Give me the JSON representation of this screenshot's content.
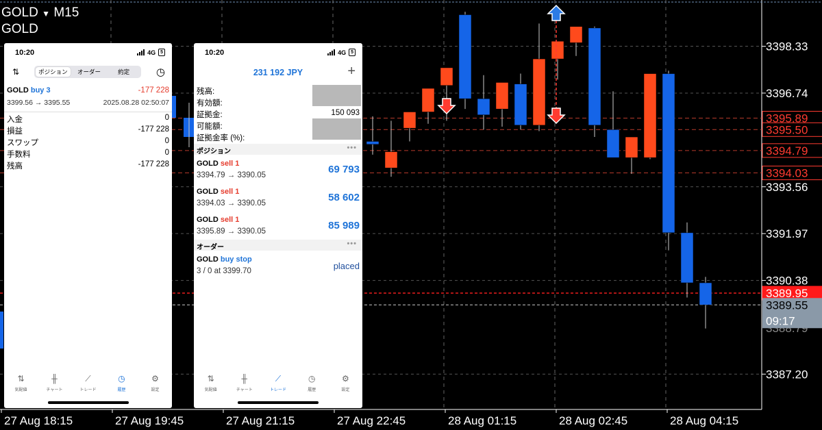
{
  "chart": {
    "symbol": "GOLD",
    "timeframe": "M15",
    "subtitle": "GOLD",
    "price_min": 3386.0,
    "price_max": 3399.9,
    "up_color": "#ff4a1c",
    "down_color": "#1565e8",
    "price_ticks": [
      "3398.33",
      "3396.74",
      "3393.56",
      "3391.97",
      "3390.38",
      "3387.20"
    ],
    "price_tick_values": [
      3398.33,
      3396.74,
      3393.56,
      3391.97,
      3390.38,
      3387.2
    ],
    "level_labels": [
      "3395.89",
      "3395.50",
      "3394.79",
      "3394.03"
    ],
    "level_values": [
      3395.89,
      3395.5,
      3394.79,
      3394.03
    ],
    "bid_label": "3389.95",
    "bid_value": 3389.95,
    "ask_label": "3389.55",
    "ask_value": 3389.55,
    "countdown": "09:17",
    "obscured_label": "3388.79",
    "time_labels": [
      "27 Aug 18:15",
      "27 Aug 19:45",
      "27 Aug 21:15",
      "27 Aug 22:45",
      "28 Aug 01:15",
      "28 Aug 02:45",
      "28 Aug 04:15"
    ],
    "candles": [
      {
        "o": 3395.1,
        "h": 3395.95,
        "l": 3394.65,
        "c": 3395.0
      },
      {
        "o": 3394.2,
        "h": 3395.8,
        "l": 3393.9,
        "c": 3394.75
      },
      {
        "o": 3395.55,
        "h": 3395.9,
        "l": 3395.1,
        "c": 3396.1
      },
      {
        "o": 3396.1,
        "h": 3396.8,
        "l": 3395.7,
        "c": 3396.9
      },
      {
        "o": 3397.0,
        "h": 3397.5,
        "l": 3395.8,
        "c": 3397.6
      },
      {
        "o": 3399.4,
        "h": 3399.5,
        "l": 3396.2,
        "c": 3396.55
      },
      {
        "o": 3396.55,
        "h": 3397.35,
        "l": 3395.5,
        "c": 3396.0
      },
      {
        "o": 3396.2,
        "h": 3396.95,
        "l": 3395.6,
        "c": 3397.1
      },
      {
        "o": 3397.05,
        "h": 3397.4,
        "l": 3395.5,
        "c": 3395.65
      },
      {
        "o": 3395.65,
        "h": 3399.1,
        "l": 3395.45,
        "c": 3397.9
      },
      {
        "o": 3397.9,
        "h": 3398.45,
        "l": 3397.2,
        "c": 3398.5
      },
      {
        "o": 3398.45,
        "h": 3398.9,
        "l": 3398.0,
        "c": 3399.0
      },
      {
        "o": 3398.95,
        "h": 3399.0,
        "l": 3395.25,
        "c": 3395.65
      },
      {
        "o": 3395.5,
        "h": 3396.8,
        "l": 3394.85,
        "c": 3394.55
      },
      {
        "o": 3394.55,
        "h": 3395.25,
        "l": 3394.0,
        "c": 3395.25
      },
      {
        "o": 3394.55,
        "h": 3397.3,
        "l": 3394.5,
        "c": 3397.4
      },
      {
        "o": 3397.4,
        "h": 3397.5,
        "l": 3391.4,
        "c": 3392.0
      },
      {
        "o": 3392.0,
        "h": 3392.35,
        "l": 3389.8,
        "c": 3390.3
      },
      {
        "o": 3390.3,
        "h": 3390.5,
        "l": 3388.75,
        "c": 3389.55
      }
    ]
  },
  "phone1": {
    "time": "10:20",
    "network": "4G",
    "battery": "5",
    "tabs": [
      "ポジション",
      "オーダー",
      "約定"
    ],
    "summary": {
      "symbol": "GOLD",
      "side": "buy 3",
      "profit": "-177 228",
      "prices": "3399.56 → 3395.55",
      "date": "2025.08.28 02:50:07"
    },
    "rows": [
      {
        "label": "入金",
        "value": "0"
      },
      {
        "label": "損益",
        "value": "-177 228"
      },
      {
        "label": "スワップ",
        "value": "0"
      },
      {
        "label": "手数料",
        "value": "0"
      },
      {
        "label": "残高",
        "value": "-177 228"
      }
    ],
    "nav": [
      "気配値",
      "チャート",
      "トレード",
      "履歴",
      "設定"
    ],
    "active_nav": "履歴"
  },
  "phone2": {
    "time": "10:20",
    "network": "4G",
    "battery": "5",
    "title": "231 192 JPY",
    "plus": "+",
    "account": [
      {
        "label": "残高:",
        "value": ""
      },
      {
        "label": "有効額:",
        "value": ""
      },
      {
        "label": "証拠金:",
        "value": "150 093"
      },
      {
        "label": "可能額:",
        "value": ""
      },
      {
        "label": "証拠金率 (%):",
        "value": ""
      }
    ],
    "positions_header": "ポジション",
    "positions": [
      {
        "symbol": "GOLD",
        "side": "sell 1",
        "prices": "3394.79 → 3390.05",
        "profit": "69 793"
      },
      {
        "symbol": "GOLD",
        "side": "sell 1",
        "prices": "3394.03 → 3390.05",
        "profit": "58 602"
      },
      {
        "symbol": "GOLD",
        "side": "sell 1",
        "prices": "3395.89 → 3390.05",
        "profit": "85 989"
      }
    ],
    "orders_header": "オーダー",
    "order": {
      "symbol": "GOLD",
      "side": "buy stop",
      "detail": "3 / 0 at 3399.70",
      "status": "placed"
    },
    "more": "•••",
    "nav": [
      "気配値",
      "チャート",
      "トレード",
      "履歴",
      "設定"
    ],
    "active_nav": "トレード"
  }
}
